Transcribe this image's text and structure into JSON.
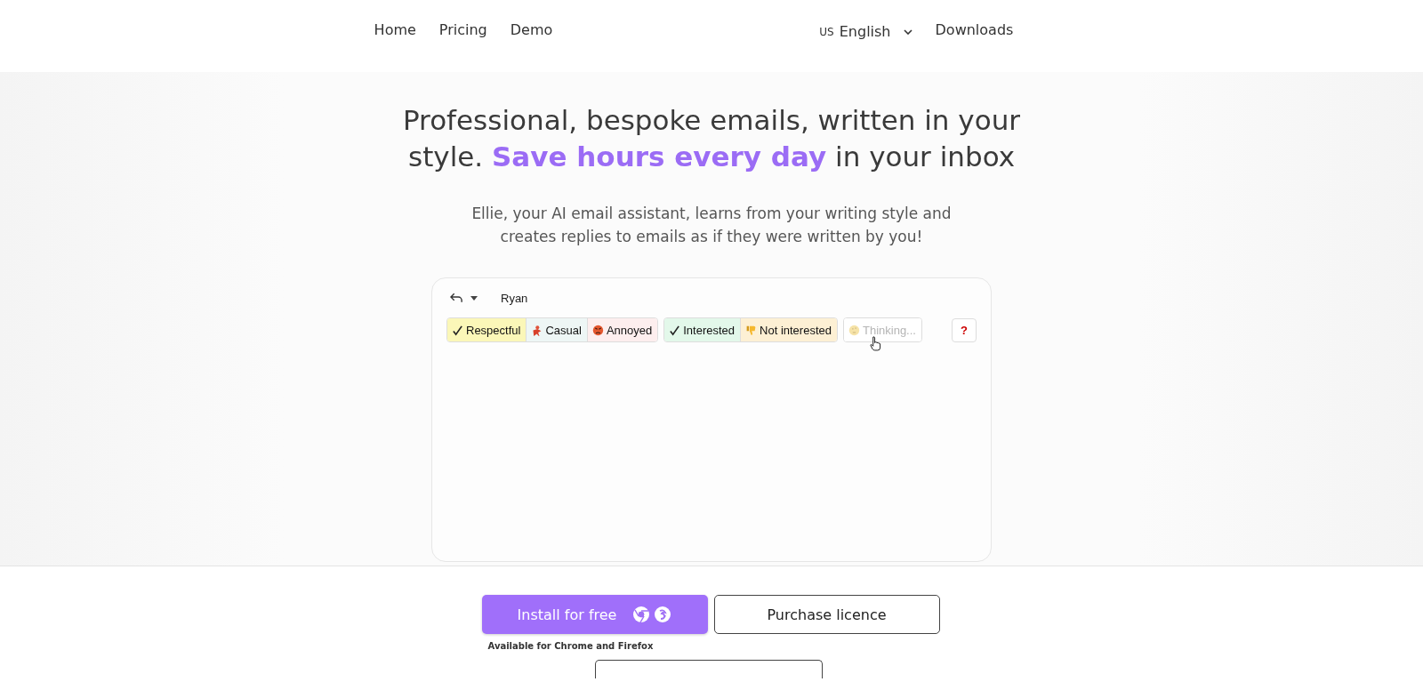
{
  "nav": {
    "links": [
      "Home",
      "Pricing",
      "Demo"
    ],
    "language": {
      "flag": "US",
      "label": "English"
    },
    "downloads": "Downloads"
  },
  "hero": {
    "title": "Professional, bespoke emails, written in your style. **Save hours every day** in your inbox",
    "subtitle": "Ellie, your AI email assistant, learns from your writing style and creates replies to emails as if they were written by you!"
  },
  "demo": {
    "recipient": "Ryan",
    "chip_groups": [
      [
        {
          "kind": "check",
          "label": "Respectful",
          "color": "#fbf7b8",
          "disabled": false
        },
        {
          "kind": "dancer",
          "label": "Casual",
          "color": "#eef6f5",
          "disabled": false
        },
        {
          "kind": "angry",
          "label": "Annoyed",
          "color": "#fdeeee",
          "disabled": false
        }
      ],
      [
        {
          "kind": "check",
          "label": "Interested",
          "color": "#e3f8ea",
          "disabled": false
        },
        {
          "kind": "thumbsdown",
          "label": "Not interested",
          "color": "#fdf0d4",
          "disabled": false
        }
      ],
      [
        {
          "kind": "thinking",
          "label": "Thinking...",
          "color": "#ffffff",
          "disabled": true
        }
      ]
    ],
    "help": "?"
  },
  "actions": {
    "install": "Install for free",
    "purchase": "Purchase licence",
    "note": "Available for Chrome and Firefox"
  }
}
